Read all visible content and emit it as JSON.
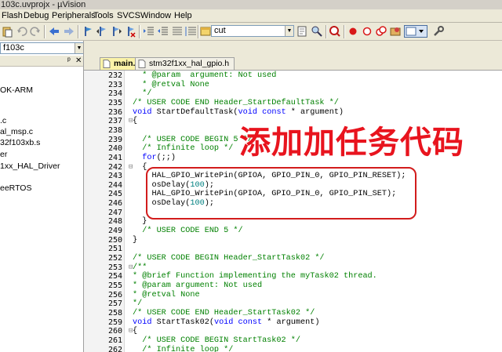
{
  "window": {
    "title": "103c.uvprojx - µVision"
  },
  "menu": [
    "Flash",
    "Debug",
    "Peripherals",
    "Tools",
    "SVCS",
    "Window",
    "Help"
  ],
  "toolbar": {
    "find_value": "cut"
  },
  "project": {
    "target": "f103c",
    "tree": [
      "OK-ARM",
      ".c",
      "al_msp.c",
      "32f103xb.s",
      "er",
      "1xx_HAL_Driver",
      "eeRTOS"
    ]
  },
  "tabs": [
    {
      "label": "main.c",
      "active": true
    },
    {
      "label": "stm32f1xx_hal_gpio.h",
      "active": false
    }
  ],
  "annotation": "添加加任务代码",
  "code_lines": [
    {
      "n": "232",
      "fold": "",
      "parts": [
        [
          "cmt",
          "  * @param  argument: Not used"
        ]
      ]
    },
    {
      "n": "233",
      "fold": "",
      "parts": [
        [
          "cmt",
          "  * @retval None"
        ]
      ]
    },
    {
      "n": "234",
      "fold": "",
      "parts": [
        [
          "cmt",
          "  */"
        ]
      ]
    },
    {
      "n": "235",
      "fold": "",
      "parts": [
        [
          "cmt",
          "/* USER CODE END Header_StartDefaultTask */"
        ]
      ]
    },
    {
      "n": "236",
      "fold": "",
      "parts": [
        [
          "kw",
          "void"
        ],
        [
          "",
          " StartDefaultTask("
        ],
        [
          "kw",
          "void"
        ],
        [
          "",
          " "
        ],
        [
          "kw",
          "const"
        ],
        [
          "",
          " * argument)"
        ]
      ]
    },
    {
      "n": "237",
      "fold": "⊟",
      "parts": [
        [
          "",
          "{"
        ]
      ]
    },
    {
      "n": "238",
      "fold": "",
      "parts": [
        [
          "",
          ""
        ]
      ]
    },
    {
      "n": "239",
      "fold": "",
      "parts": [
        [
          "cmt",
          "  /* USER CODE BEGIN 5 */"
        ]
      ]
    },
    {
      "n": "240",
      "fold": "",
      "parts": [
        [
          "cmt",
          "  /* Infinite loop */"
        ]
      ]
    },
    {
      "n": "241",
      "fold": "",
      "parts": [
        [
          "",
          "  "
        ],
        [
          "kw",
          "for"
        ],
        [
          "",
          "(;;)"
        ]
      ]
    },
    {
      "n": "242",
      "fold": "⊟",
      "parts": [
        [
          "",
          "  {"
        ]
      ]
    },
    {
      "n": "243",
      "fold": "",
      "parts": [
        [
          "",
          "    HAL_GPIO_WritePin(GPIOA, GPIO_PIN_0, GPIO_PIN_RESET);"
        ]
      ]
    },
    {
      "n": "244",
      "fold": "",
      "parts": [
        [
          "",
          "    osDelay("
        ],
        [
          "num",
          "100"
        ],
        [
          "",
          ");"
        ]
      ]
    },
    {
      "n": "245",
      "fold": "",
      "parts": [
        [
          "",
          "    HAL_GPIO_WritePin(GPIOA, GPIO_PIN_0, GPIO_PIN_SET);"
        ]
      ]
    },
    {
      "n": "246",
      "fold": "",
      "parts": [
        [
          "",
          "    osDelay("
        ],
        [
          "num",
          "100"
        ],
        [
          "",
          ");"
        ]
      ]
    },
    {
      "n": "247",
      "fold": "",
      "parts": [
        [
          "",
          ""
        ]
      ]
    },
    {
      "n": "248",
      "fold": "",
      "parts": [
        [
          "",
          "  }"
        ]
      ]
    },
    {
      "n": "249",
      "fold": "",
      "parts": [
        [
          "cmt",
          "  /* USER CODE END 5 */"
        ]
      ]
    },
    {
      "n": "250",
      "fold": "",
      "parts": [
        [
          "",
          "}"
        ]
      ]
    },
    {
      "n": "251",
      "fold": "",
      "parts": [
        [
          "",
          ""
        ]
      ]
    },
    {
      "n": "252",
      "fold": "",
      "parts": [
        [
          "cmt",
          "/* USER CODE BEGIN Header_StartTask02 */"
        ]
      ]
    },
    {
      "n": "253",
      "fold": "⊟",
      "parts": [
        [
          "cmt",
          "/**"
        ]
      ]
    },
    {
      "n": "254",
      "fold": "",
      "parts": [
        [
          "cmt",
          "* @brief Function implementing the myTask02 thread."
        ]
      ]
    },
    {
      "n": "255",
      "fold": "",
      "parts": [
        [
          "cmt",
          "* @param argument: Not used"
        ]
      ]
    },
    {
      "n": "256",
      "fold": "",
      "parts": [
        [
          "cmt",
          "* @retval None"
        ]
      ]
    },
    {
      "n": "257",
      "fold": "",
      "parts": [
        [
          "cmt",
          "*/"
        ]
      ]
    },
    {
      "n": "258",
      "fold": "",
      "parts": [
        [
          "cmt",
          "/* USER CODE END Header_StartTask02 */"
        ]
      ]
    },
    {
      "n": "259",
      "fold": "",
      "parts": [
        [
          "kw",
          "void"
        ],
        [
          "",
          " StartTask02("
        ],
        [
          "kw",
          "void"
        ],
        [
          "",
          " "
        ],
        [
          "kw",
          "const"
        ],
        [
          "",
          " * argument)"
        ]
      ]
    },
    {
      "n": "260",
      "fold": "⊟",
      "parts": [
        [
          "",
          "{"
        ]
      ]
    },
    {
      "n": "261",
      "fold": "",
      "parts": [
        [
          "cmt",
          "  /* USER CODE BEGIN StartTask02 */"
        ]
      ]
    },
    {
      "n": "262",
      "fold": "",
      "parts": [
        [
          "cmt",
          "  /* Infinite loop */"
        ]
      ]
    }
  ]
}
